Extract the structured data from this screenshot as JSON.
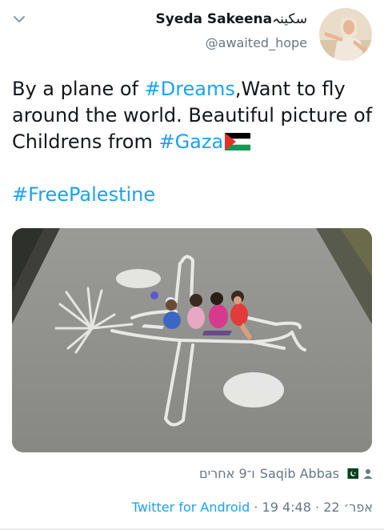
{
  "header": {
    "display_name": "Syeda Sakeena",
    "display_name_urdu": "سکینہ",
    "handle": "@awaited_hope",
    "chevron_icon": "chevron-down-icon"
  },
  "tweet": {
    "line1_a": "By a plane of ",
    "hashtag_dreams": "#Dreams",
    "line1_b": ",Want to fly around the world. Beautiful picture of Childrens from ",
    "hashtag_gaza": "#Gaza",
    "flag": "palestine-flag-icon",
    "hashtag_freepalestine": "#FreePalestine"
  },
  "retweet_context": {
    "others": "ו־9 אחרים",
    "name": "Saqib Abbas",
    "flag": "pakistan-flag-icon",
    "icon": "person-icon"
  },
  "meta": {
    "source": "Twitter for Android",
    "date": "19 אפר׳ 22",
    "time": "4:48"
  },
  "colors": {
    "link": "#1da1f2",
    "secondary": "#657786"
  }
}
